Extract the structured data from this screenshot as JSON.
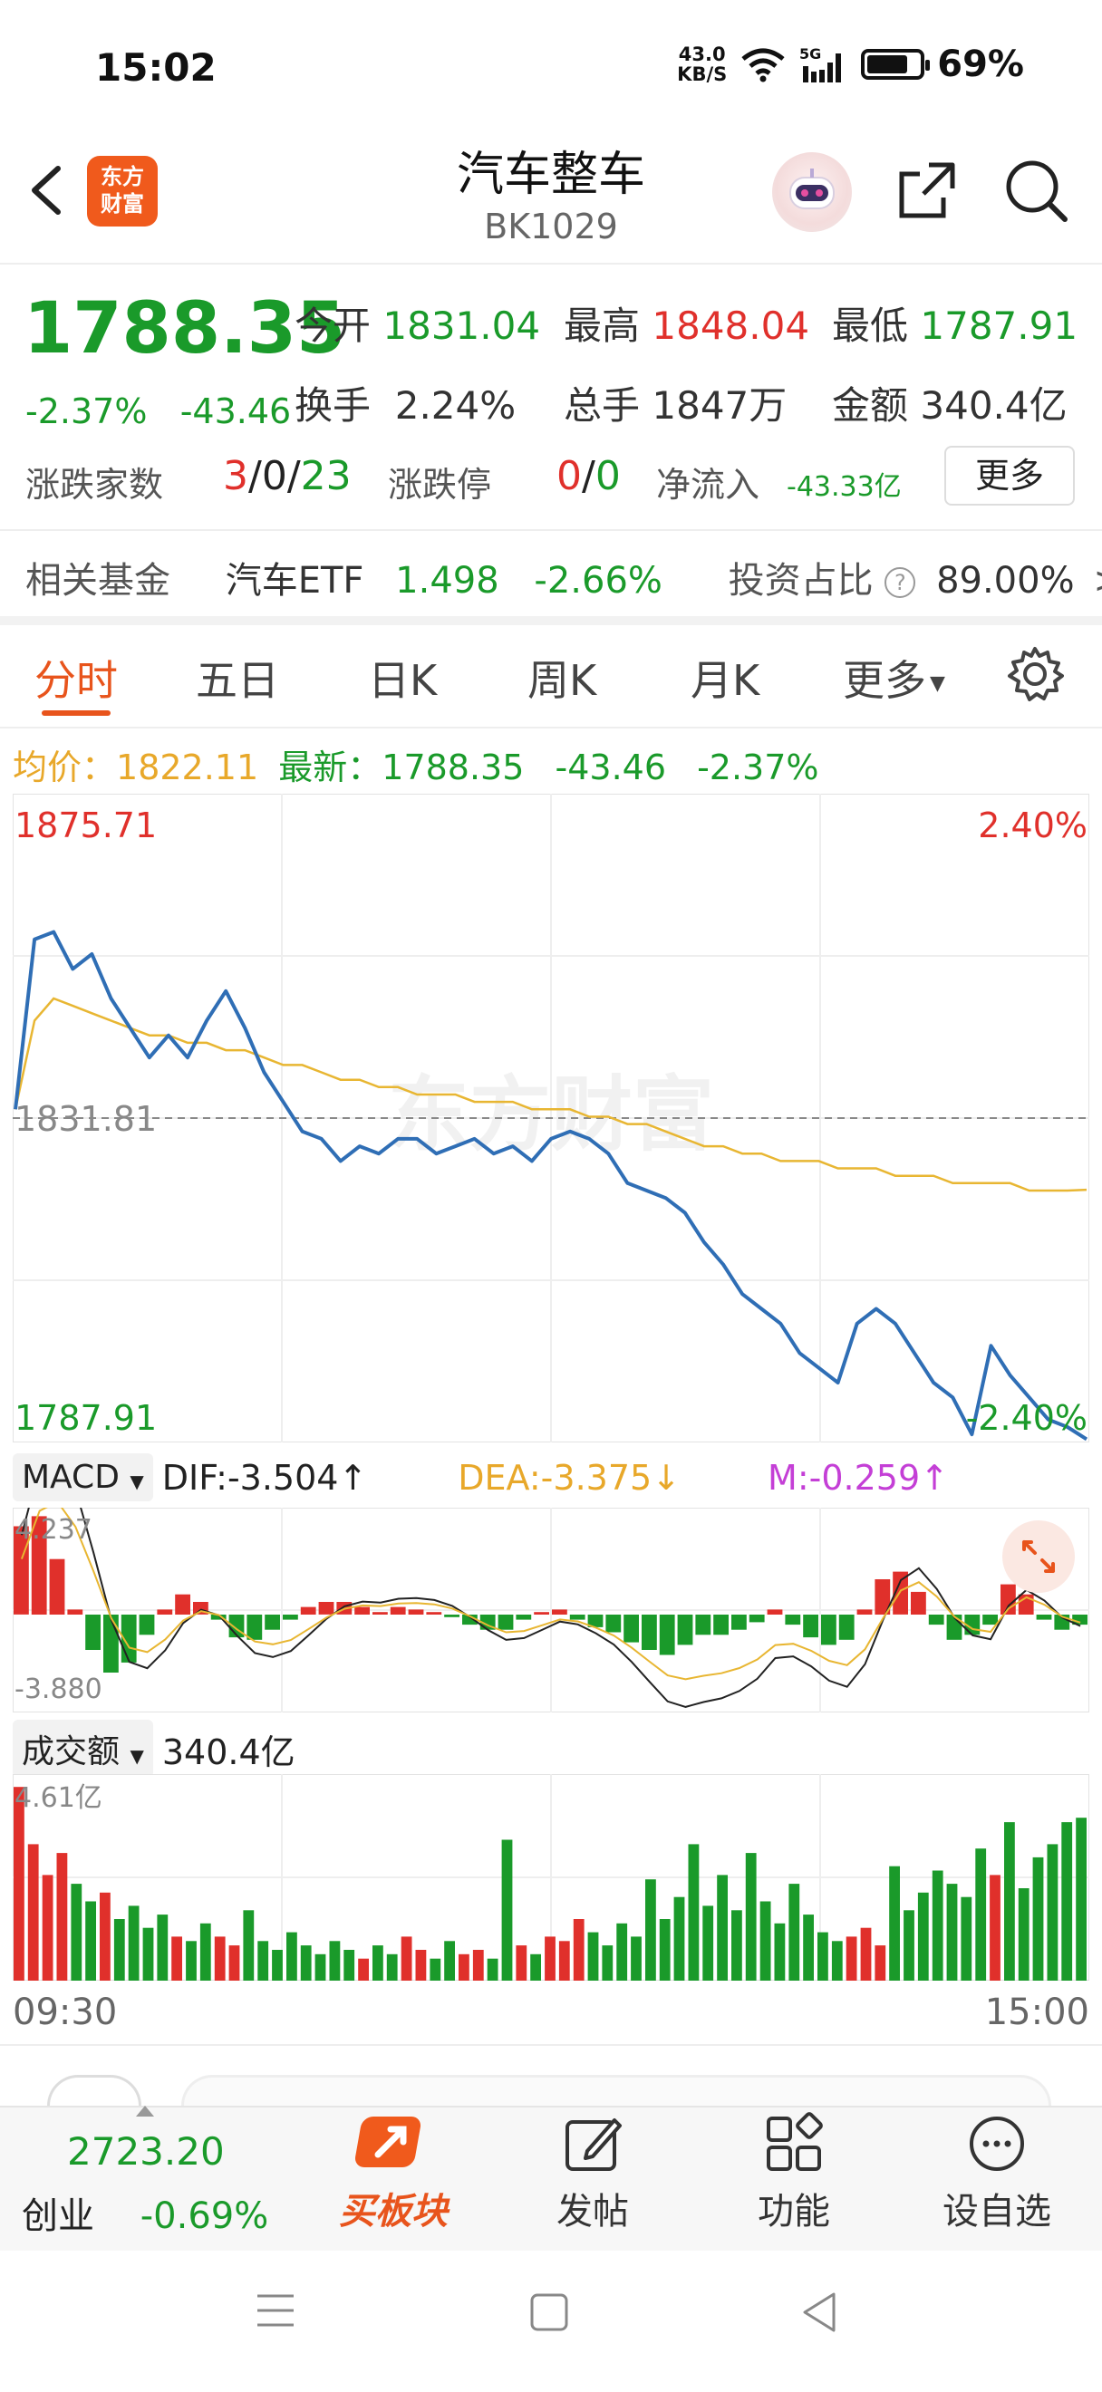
{
  "status": {
    "time": "15:02",
    "netspeed_value": "43.0",
    "netspeed_unit": "KB/S",
    "signal": "5G",
    "battery": "69%"
  },
  "header": {
    "title": "汽车整车",
    "code": "BK1029",
    "logo_line1": "东方",
    "logo_line2": "财富"
  },
  "quote": {
    "price": "1788.35",
    "change_pct": "-2.37%",
    "change_abs": "-43.46",
    "open_label": "今开",
    "open": "1831.04",
    "high_label": "最高",
    "high": "1848.04",
    "low_label": "最低",
    "low": "1787.91",
    "turnover_label": "换手",
    "turnover": "2.24%",
    "volume_label": "总手",
    "volume": "1847万",
    "amount_label": "金额",
    "amount": "340.4亿",
    "breadth_label": "涨跌家数",
    "breadth_up": "3",
    "breadth_flat": "0",
    "breadth_down": "23",
    "sep": "/",
    "limit_label": "涨跌停",
    "limit_up": "0",
    "limit_down": "0",
    "netflow_label": "净流入",
    "netflow": "-43.33亿",
    "more_label": "更多"
  },
  "fund": {
    "label": "相关基金",
    "name": "汽车ETF",
    "price": "1.498",
    "pct": "-2.66%",
    "ratio_label": "投资占比",
    "ratio": "89.00%",
    "arrow": ">"
  },
  "tabs": {
    "fenshi": "分时",
    "wuri": "五日",
    "rik": "日K",
    "zhouk": "周K",
    "yuek": "月K",
    "more": "更多"
  },
  "avg_row": {
    "avg_label": "均价：",
    "avg": "1822.11",
    "latest_label": "最新：",
    "latest": "1788.35",
    "chg": "-43.46",
    "pct": "-2.37%"
  },
  "chart_labels": {
    "top_price": "1875.71",
    "top_pct": "2.40%",
    "mid_price": "1831.81",
    "bottom_price": "1787.91",
    "bottom_pct": "-2.40%",
    "watermark": "东方财富"
  },
  "macd": {
    "selector": "MACD",
    "dif": "DIF:-3.504↑",
    "dea": "DEA:-3.375↓",
    "m": "M:-0.259↑",
    "top": "4.237",
    "bottom": "-3.880"
  },
  "vol": {
    "selector": "成交额",
    "total": "340.4亿",
    "max": "4.61亿"
  },
  "time_axis": {
    "start": "09:30",
    "end": "15:00"
  },
  "bottom_nav": {
    "index_value": "2723.20",
    "index_name": "创业",
    "index_pct": "-0.69%",
    "buy": "买板块",
    "post": "发帖",
    "func": "功能",
    "fav": "设自选"
  },
  "colors": {
    "up": "#e0302b",
    "down": "#1a9a2a",
    "price_line": "#2f6eb5",
    "avg_line": "#e8b632",
    "accent": "#e8541c"
  },
  "chart_data": {
    "type": "line",
    "x_range": [
      "09:30",
      "15:00"
    ],
    "ylim": [
      1787.91,
      1875.71
    ],
    "prev_close": 1831.81,
    "series": [
      {
        "name": "最新",
        "values": [
          1833,
          1856,
          1857,
          1852,
          1854,
          1848,
          1844,
          1840,
          1843,
          1840,
          1845,
          1849,
          1844,
          1838,
          1834,
          1830,
          1829,
          1826,
          1828,
          1827,
          1829,
          1829,
          1827,
          1828,
          1829,
          1827,
          1828,
          1826,
          1829,
          1830,
          1829,
          1827,
          1823,
          1822,
          1821,
          1819,
          1815,
          1812,
          1808,
          1806,
          1804,
          1800,
          1798,
          1796,
          1804,
          1806,
          1804,
          1800,
          1796,
          1794,
          1789,
          1801,
          1797,
          1794,
          1791,
          1790,
          1788.35
        ]
      },
      {
        "name": "均价",
        "values": [
          1833,
          1845,
          1848,
          1847,
          1846,
          1845,
          1844,
          1843,
          1843,
          1842,
          1842,
          1841,
          1841,
          1840,
          1839,
          1839,
          1838,
          1837,
          1837,
          1836,
          1836,
          1835,
          1835,
          1835,
          1834,
          1834,
          1834,
          1833,
          1833,
          1833,
          1832,
          1832,
          1831,
          1831,
          1830,
          1829,
          1828,
          1828,
          1827,
          1827,
          1826,
          1826,
          1826,
          1825,
          1825,
          1825,
          1824,
          1824,
          1824,
          1823,
          1823,
          1823,
          1823,
          1822,
          1822,
          1822,
          1822.11
        ]
      }
    ],
    "macd": {
      "ylim": [
        -3.88,
        4.237
      ],
      "histogram": [
        3.5,
        3.9,
        2.2,
        0.2,
        -1.4,
        -2.3,
        -1.9,
        -0.8,
        0.2,
        0.8,
        0.5,
        -0.2,
        -0.9,
        -1.0,
        -0.6,
        -0.2,
        0.3,
        0.5,
        0.5,
        0.3,
        0.1,
        0.3,
        0.2,
        0.1,
        -0.1,
        -0.4,
        -0.6,
        -0.6,
        -0.2,
        0.1,
        0.2,
        -0.2,
        -0.5,
        -0.7,
        -1.1,
        -1.4,
        -1.6,
        -1.2,
        -0.8,
        -0.8,
        -0.6,
        -0.3,
        0.2,
        -0.4,
        -0.9,
        -1.2,
        -1.0,
        0.2,
        1.4,
        1.7,
        0.9,
        -0.4,
        -1.0,
        -0.8,
        -0.4,
        1.2,
        0.8,
        -0.2,
        -0.6,
        -0.4
      ]
    },
    "volume": {
      "max": 4.61,
      "unit": "亿",
      "values": [
        4.4,
        3.1,
        2.4,
        2.9,
        2.2,
        1.8,
        2.0,
        1.4,
        1.7,
        1.2,
        1.5,
        1.0,
        0.9,
        1.3,
        1.0,
        0.8,
        1.6,
        0.9,
        0.7,
        1.1,
        0.8,
        0.6,
        0.9,
        0.7,
        0.5,
        0.8,
        0.6,
        1.0,
        0.7,
        0.5,
        0.9,
        0.6,
        0.7,
        0.5,
        3.2,
        0.8,
        0.6,
        1.0,
        0.9,
        1.4,
        1.1,
        0.8,
        1.3,
        1.0,
        2.3,
        1.4,
        1.9,
        3.1,
        1.7,
        2.4,
        1.6,
        2.9,
        1.8,
        1.3,
        2.2,
        1.5,
        1.1,
        0.9,
        1.0,
        1.2,
        0.8,
        2.6,
        1.6,
        2.0,
        2.5,
        2.2,
        1.9,
        3.0,
        2.4,
        3.6,
        2.1,
        2.8,
        3.1,
        3.6,
        3.7
      ]
    }
  }
}
